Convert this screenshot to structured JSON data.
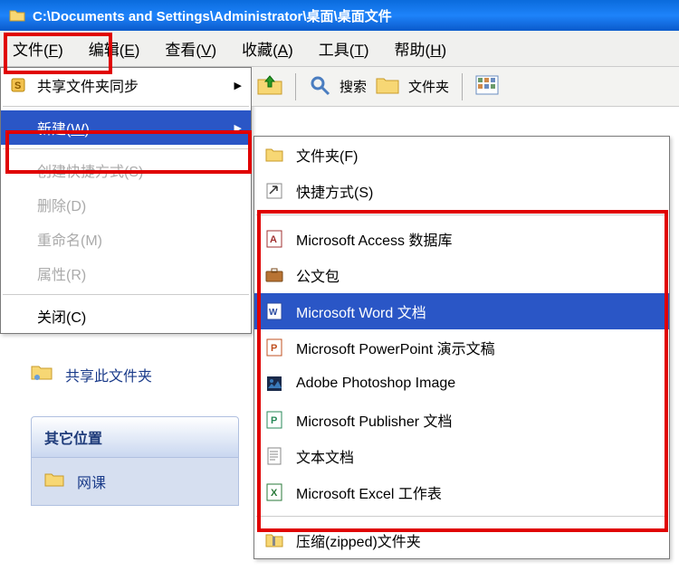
{
  "title_bar": {
    "path": "C:\\Documents and Settings\\Administrator\\桌面\\桌面文件"
  },
  "menu_bar": {
    "file": "文件(F)",
    "edit": "编辑(E)",
    "view": "查看(V)",
    "favorites": "收藏(A)",
    "tools": "工具(T)",
    "help": "帮助(H)"
  },
  "toolbar": {
    "search": "搜索",
    "folders": "文件夹"
  },
  "file_menu": {
    "share_sync": "共享文件夹同步",
    "new": "新建(W)",
    "create_shortcut": "创建快捷方式(S)",
    "delete": "删除(D)",
    "rename": "重命名(M)",
    "properties": "属性(R)",
    "close": "关闭(C)"
  },
  "new_submenu": {
    "folder": "文件夹(F)",
    "shortcut": "快捷方式(S)",
    "access": "Microsoft Access 数据库",
    "briefcase": "公文包",
    "word": "Microsoft Word 文档",
    "powerpoint": "Microsoft PowerPoint 演示文稿",
    "photoshop": "Adobe Photoshop Image",
    "publisher": "Microsoft Publisher 文档",
    "text": "文本文档",
    "excel": "Microsoft Excel 工作表",
    "zip": "压缩(zipped)文件夹"
  },
  "tasks": {
    "share_this": "共享此文件夹"
  },
  "other_places": {
    "header": "其它位置",
    "netclass": "网课"
  }
}
